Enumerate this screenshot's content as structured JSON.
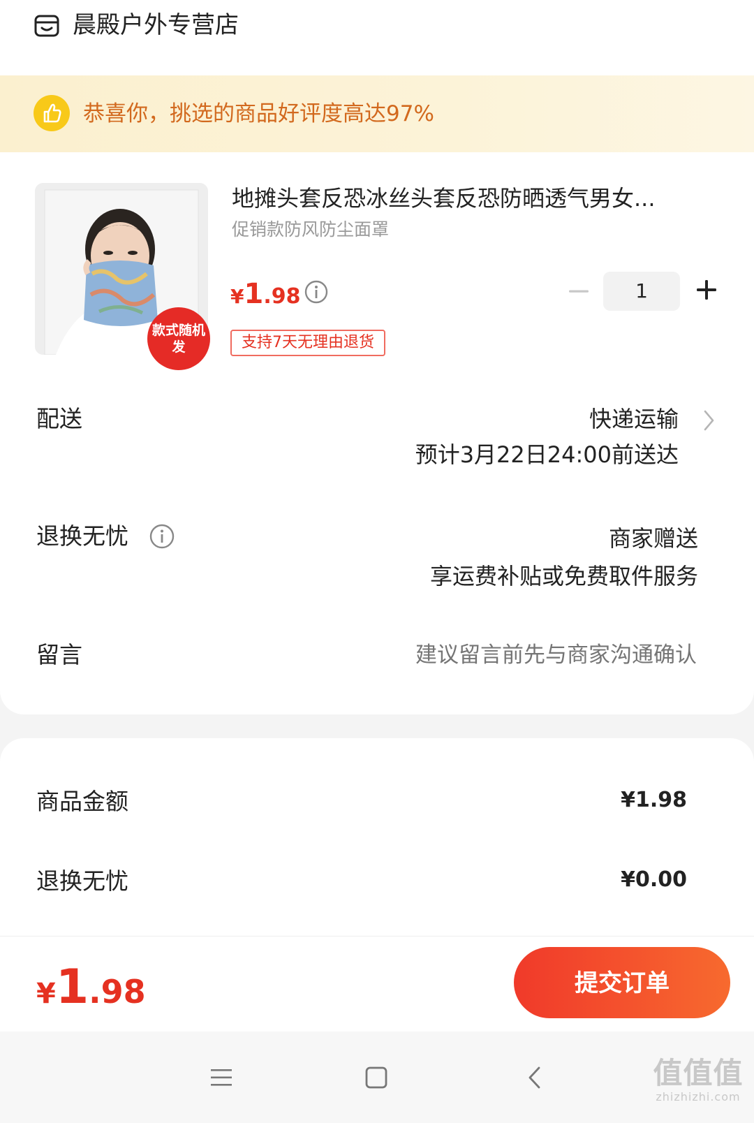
{
  "store": {
    "name": "晨殿户外专营店",
    "icon": "store-icon"
  },
  "banner": {
    "text": "恭喜你，挑选的商品好评度高达97%",
    "icon": "thumbs-up-icon",
    "color": "#d2691e"
  },
  "product": {
    "title": "地摊头套反恐冰丝头套反恐防晒透气男女...",
    "subtitle": "促销款防风防尘面罩",
    "badge": "款式随机发",
    "price_currency": "¥",
    "price_int": "1",
    "price_dec": ".98",
    "quantity": "1",
    "tag": "支持7天无理由退货"
  },
  "delivery": {
    "label": "配送",
    "value": "快递运输",
    "estimate": "预计3月22日24:00前送达"
  },
  "warranty": {
    "label": "退换无忧",
    "value": "商家赠送",
    "detail": "享运费补贴或免费取件服务"
  },
  "message": {
    "label": "留言",
    "placeholder": "建议留言前先与商家沟通确认"
  },
  "summary": {
    "goods_label": "商品金额",
    "goods_value": "¥1.98",
    "warranty_label": "退换无忧",
    "warranty_value": "¥0.00"
  },
  "footer": {
    "total_currency": "¥",
    "total_int": "1",
    "total_dec": ".98",
    "submit_label": "提交订单"
  },
  "watermark": {
    "mark": "值值值",
    "site": "zhizhizhi.com"
  },
  "colors": {
    "accent": "#e53121",
    "submit": "#f4512d",
    "banner_bg": "#fbf0cf"
  }
}
